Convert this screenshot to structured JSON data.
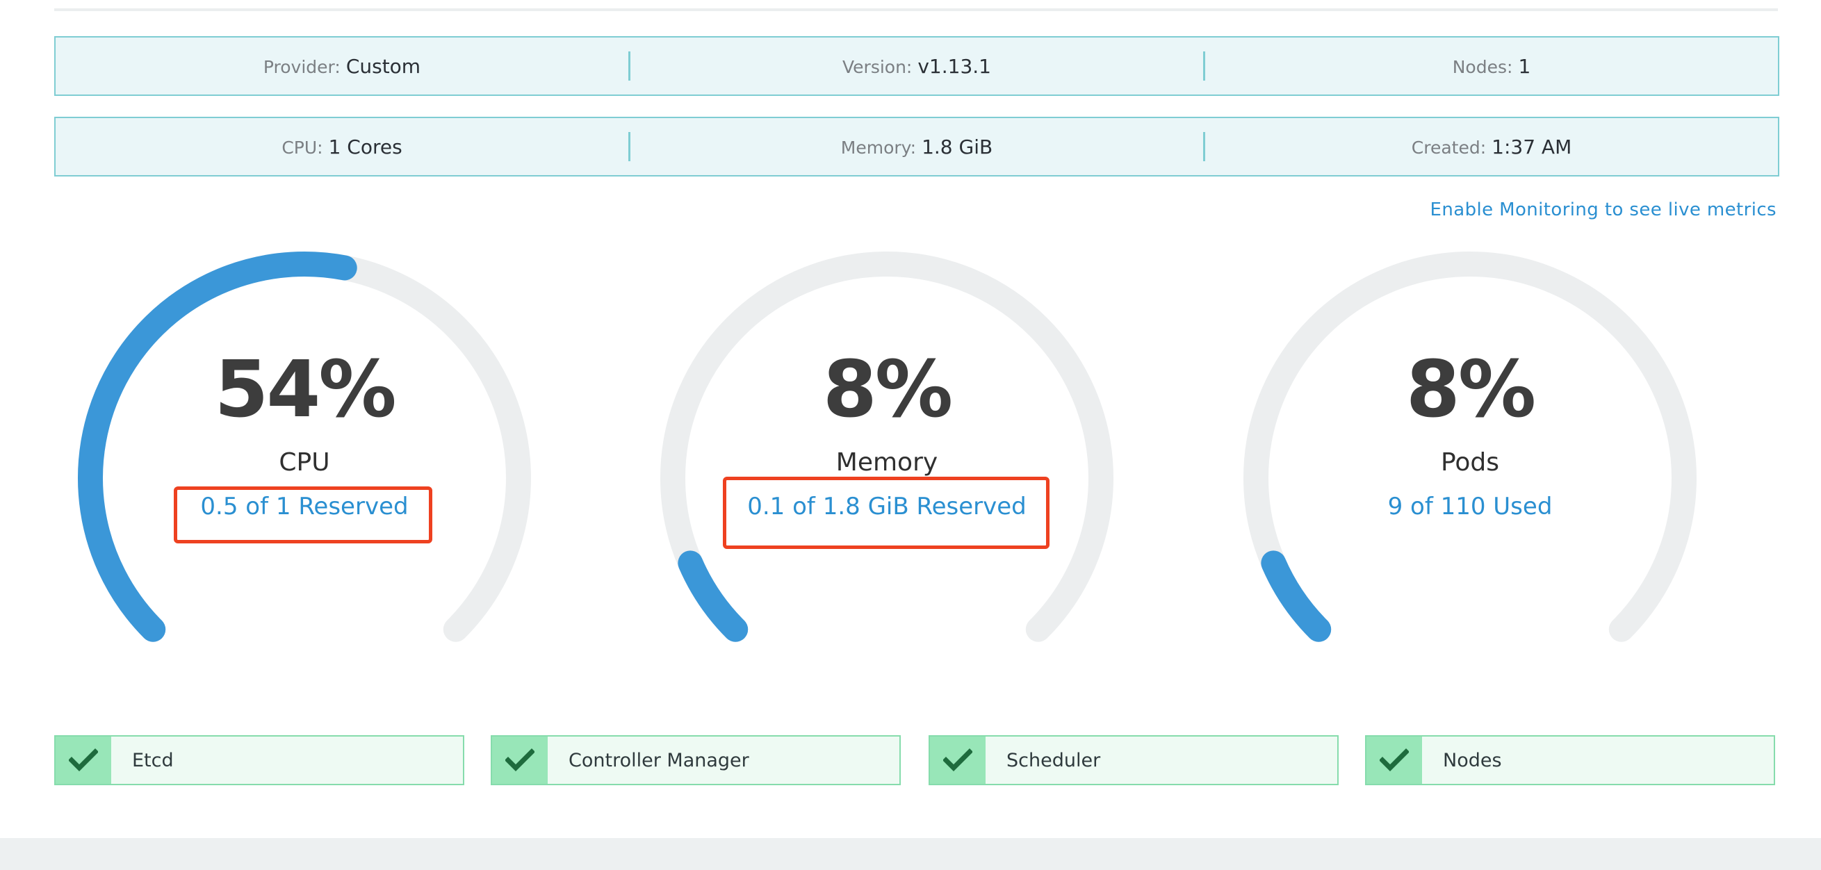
{
  "info_rows": [
    [
      {
        "label": "Provider:",
        "value": "Custom"
      },
      {
        "label": "Version:",
        "value": "v1.13.1"
      },
      {
        "label": "Nodes:",
        "value": "1"
      }
    ],
    [
      {
        "label": "CPU:",
        "value": "1 Cores"
      },
      {
        "label": "Memory:",
        "value": "1.8 GiB"
      },
      {
        "label": "Created:",
        "value": "1:37 AM"
      }
    ]
  ],
  "monitoring_link": "Enable Monitoring to see live metrics",
  "gauges": [
    {
      "percent_text": "54%",
      "percent": 54,
      "label": "CPU",
      "detail": "0.5 of 1 Reserved",
      "highlighted": true
    },
    {
      "percent_text": "8%",
      "percent": 8,
      "label": "Memory",
      "detail": "0.1 of 1.8 GiB Reserved",
      "highlighted": true
    },
    {
      "percent_text": "8%",
      "percent": 8,
      "label": "Pods",
      "detail": "9 of 110 Used",
      "highlighted": false
    }
  ],
  "components": [
    {
      "name": "Etcd",
      "status_icon": "check-icon"
    },
    {
      "name": "Controller Manager",
      "status_icon": "check-icon"
    },
    {
      "name": "Scheduler",
      "status_icon": "check-icon"
    },
    {
      "name": "Nodes",
      "status_icon": "check-icon"
    }
  ],
  "colors": {
    "gauge_fill": "#3b97d8",
    "gauge_track": "#eceeef",
    "info_bg": "#eaf6f8",
    "info_border": "#7fcdd3",
    "link": "#2a8fd1",
    "highlight": "#ee4120",
    "status_ok_bg": "#98e6b8",
    "status_ok_check": "#1e6b3d"
  }
}
